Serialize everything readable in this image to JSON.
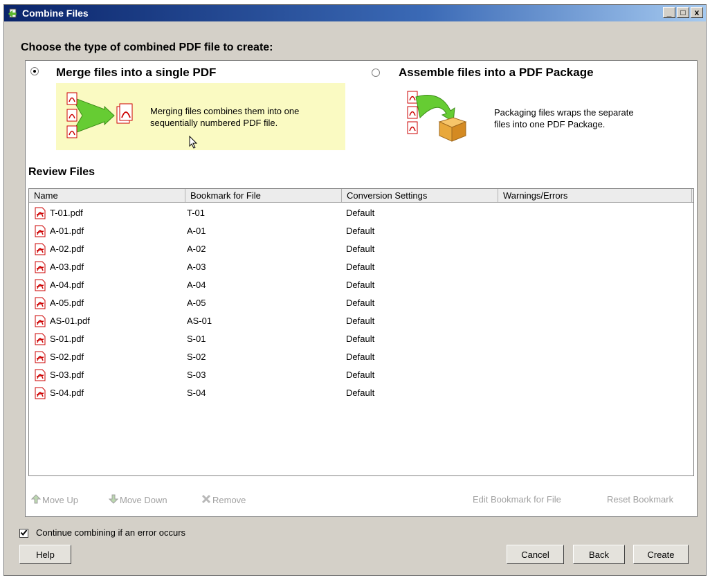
{
  "window": {
    "title": "Combine Files",
    "controls": {
      "minimize": "_",
      "maximize": "□",
      "close": "x"
    }
  },
  "heading": "Choose the type of combined PDF file to create:",
  "options": {
    "merge": {
      "label": "Merge files into a single PDF",
      "selected": true,
      "description_line1": "Merging files combines them into one",
      "description_line2": "sequentially numbered PDF file."
    },
    "assemble": {
      "label": "Assemble files into a PDF Package",
      "selected": false,
      "description_line1": "Packaging files wraps the separate",
      "description_line2": "files into one PDF Package."
    }
  },
  "review": {
    "title": "Review Files",
    "columns": [
      "Name",
      "Bookmark for File",
      "Conversion Settings",
      "Warnings/Errors"
    ],
    "rows": [
      {
        "name": "T-01.pdf",
        "bookmark": "T-01",
        "conversion": "Default",
        "warnings": ""
      },
      {
        "name": "A-01.pdf",
        "bookmark": "A-01",
        "conversion": "Default",
        "warnings": ""
      },
      {
        "name": "A-02.pdf",
        "bookmark": "A-02",
        "conversion": "Default",
        "warnings": ""
      },
      {
        "name": "A-03.pdf",
        "bookmark": "A-03",
        "conversion": "Default",
        "warnings": ""
      },
      {
        "name": "A-04.pdf",
        "bookmark": "A-04",
        "conversion": "Default",
        "warnings": ""
      },
      {
        "name": "A-05.pdf",
        "bookmark": "A-05",
        "conversion": "Default",
        "warnings": ""
      },
      {
        "name": "AS-01.pdf",
        "bookmark": "AS-01",
        "conversion": "Default",
        "warnings": ""
      },
      {
        "name": "S-01.pdf",
        "bookmark": "S-01",
        "conversion": "Default",
        "warnings": ""
      },
      {
        "name": "S-02.pdf",
        "bookmark": "S-02",
        "conversion": "Default",
        "warnings": ""
      },
      {
        "name": "S-03.pdf",
        "bookmark": "S-03",
        "conversion": "Default",
        "warnings": ""
      },
      {
        "name": "S-04.pdf",
        "bookmark": "S-04",
        "conversion": "Default",
        "warnings": ""
      }
    ]
  },
  "toolbar": {
    "move_up": "Move Up",
    "move_down": "Move Down",
    "remove": "Remove",
    "edit_bookmark": "Edit Bookmark for File",
    "reset_bookmark": "Reset Bookmark"
  },
  "continue_checkbox": {
    "label": "Continue combining if an error occurs",
    "checked": true
  },
  "buttons": {
    "help": "Help",
    "cancel": "Cancel",
    "back": "Back",
    "create": "Create"
  },
  "colors": {
    "titlebar": "#0a246a",
    "merge_highlight": "#fafac2",
    "pdf_red": "#cc0000",
    "arrow_green": "#66cc33"
  }
}
